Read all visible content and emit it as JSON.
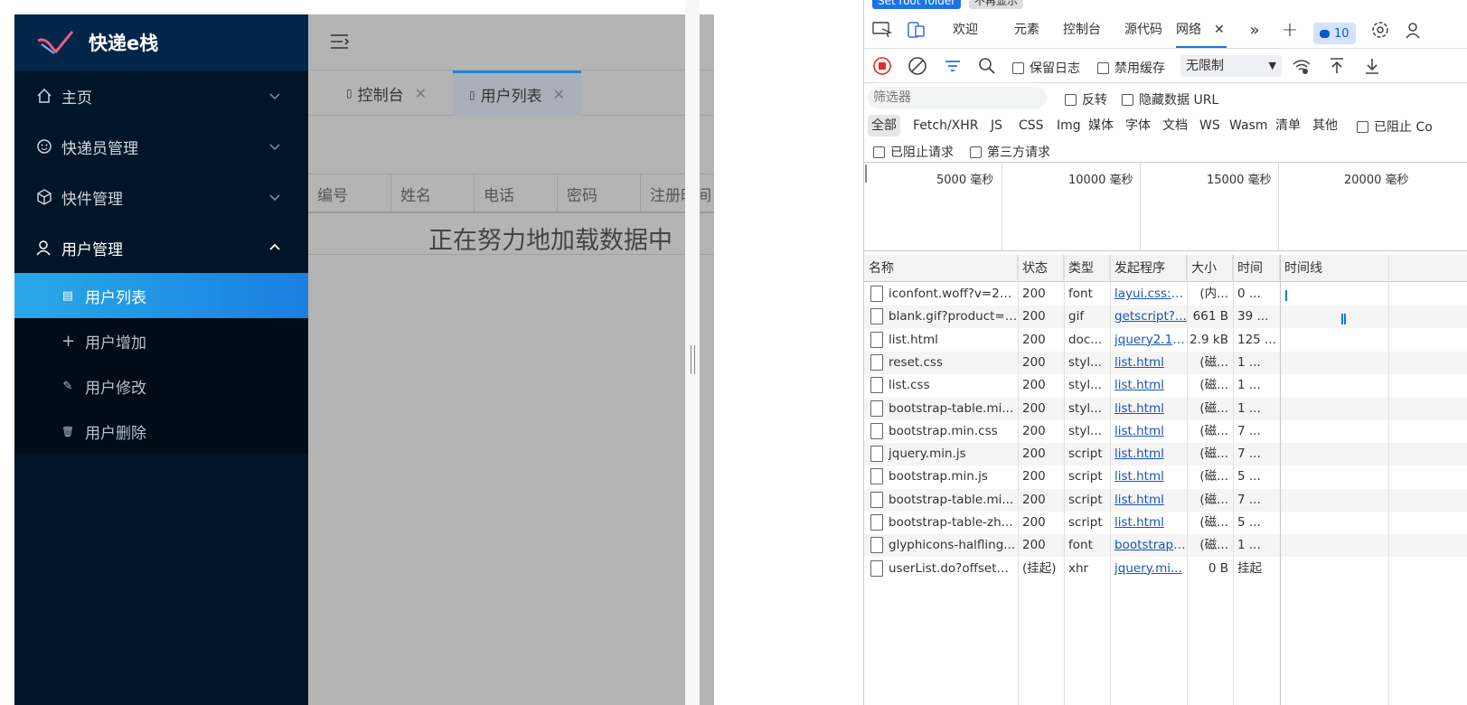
{
  "app": {
    "brand": "快递e栈",
    "menu": [
      {
        "label": "主页",
        "icon": "home-icon"
      },
      {
        "label": "快递员管理",
        "icon": "courier-icon"
      },
      {
        "label": "快件管理",
        "icon": "package-icon"
      },
      {
        "label": "用户管理",
        "icon": "user-icon"
      }
    ],
    "submenu": [
      {
        "label": "用户列表",
        "icon": "document-icon",
        "glyph": "▤"
      },
      {
        "label": "用户增加",
        "icon": "plus-icon",
        "glyph": "+"
      },
      {
        "label": "用户修改",
        "icon": "edit-icon",
        "glyph": "✎"
      },
      {
        "label": "用户删除",
        "icon": "trash-icon",
        "glyph": "🗑"
      }
    ],
    "tabs": [
      {
        "label": "控制台",
        "close": "✕"
      },
      {
        "label": "用户列表",
        "close": "✕"
      }
    ],
    "table_headers": [
      "编号",
      "姓名",
      "电话",
      "密码",
      "注册时间"
    ],
    "loading_text": "正在努力地加载数据中"
  },
  "devtools": {
    "top_strip": {
      "button1": "Set root folder",
      "button2": "不再显示"
    },
    "tabs": [
      "欢迎",
      "元素",
      "控制台",
      "源代码",
      "网络"
    ],
    "active_tab": "网络",
    "issues_count": "10",
    "toolbar": {
      "preserve_log": "保留日志",
      "disable_cache": "禁用缓存",
      "throttle": "无限制"
    },
    "filter": {
      "placeholder": "筛选器",
      "invert": "反转",
      "hide_data_urls": "隐藏数据 URL"
    },
    "types": [
      "全部",
      "Fetch/XHR",
      "JS",
      "CSS",
      "Img",
      "媒体",
      "字体",
      "文档",
      "WS",
      "Wasm",
      "清单",
      "其他"
    ],
    "blocked_cookies": "已阻止 Co",
    "blocked_requests": "已阻止请求",
    "third_party": "第三方请求",
    "timeline_ticks": [
      "5000 毫秒",
      "10000 毫秒",
      "15000 毫秒",
      "20000 毫秒"
    ],
    "columns": [
      "名称",
      "状态",
      "类型",
      "发起程序",
      "大小",
      "时间",
      "时间线"
    ],
    "rows": [
      {
        "name": "iconfont.woff?v=22...",
        "status": "200",
        "type": "font",
        "initiator": "layui.css:-...",
        "size": "(内...",
        "time": "0 ..."
      },
      {
        "name": "blank.gif?product=j...",
        "status": "200",
        "type": "gif",
        "initiator": "getscript?...",
        "size": "661 B",
        "time": "39 ..."
      },
      {
        "name": "list.html",
        "status": "200",
        "type": "doc...",
        "initiator": "jquery2.1....",
        "size": "2.9 kB",
        "time": "125 ..."
      },
      {
        "name": "reset.css",
        "status": "200",
        "type": "styl...",
        "initiator": "list.html",
        "size": "(磁...",
        "time": "1 ..."
      },
      {
        "name": "list.css",
        "status": "200",
        "type": "styl...",
        "initiator": "list.html",
        "size": "(磁...",
        "time": "1 ..."
      },
      {
        "name": "bootstrap-table.mi...",
        "status": "200",
        "type": "styl...",
        "initiator": "list.html",
        "size": "(磁...",
        "time": "1 ..."
      },
      {
        "name": "bootstrap.min.css",
        "status": "200",
        "type": "styl...",
        "initiator": "list.html",
        "size": "(磁...",
        "time": "7 ..."
      },
      {
        "name": "jquery.min.js",
        "status": "200",
        "type": "script",
        "initiator": "list.html",
        "size": "(磁...",
        "time": "7 ..."
      },
      {
        "name": "bootstrap.min.js",
        "status": "200",
        "type": "script",
        "initiator": "list.html",
        "size": "(磁...",
        "time": "5 ..."
      },
      {
        "name": "bootstrap-table.mi...",
        "status": "200",
        "type": "script",
        "initiator": "list.html",
        "size": "(磁...",
        "time": "7 ..."
      },
      {
        "name": "bootstrap-table-zh...",
        "status": "200",
        "type": "script",
        "initiator": "list.html",
        "size": "(磁...",
        "time": "5 ..."
      },
      {
        "name": "glyphicons-halfling...",
        "status": "200",
        "type": "font",
        "initiator": "bootstrap....",
        "size": "(磁...",
        "time": "1 ..."
      },
      {
        "name": "userList.do?offset=...",
        "status": "(挂起)",
        "type": "xhr",
        "initiator": "jquery.mi...",
        "size": "0 B",
        "time": "挂起"
      }
    ]
  },
  "colors": {
    "sidebar": "#011528",
    "accent": "#1a73e8",
    "active_menu": "#29a9e8"
  }
}
